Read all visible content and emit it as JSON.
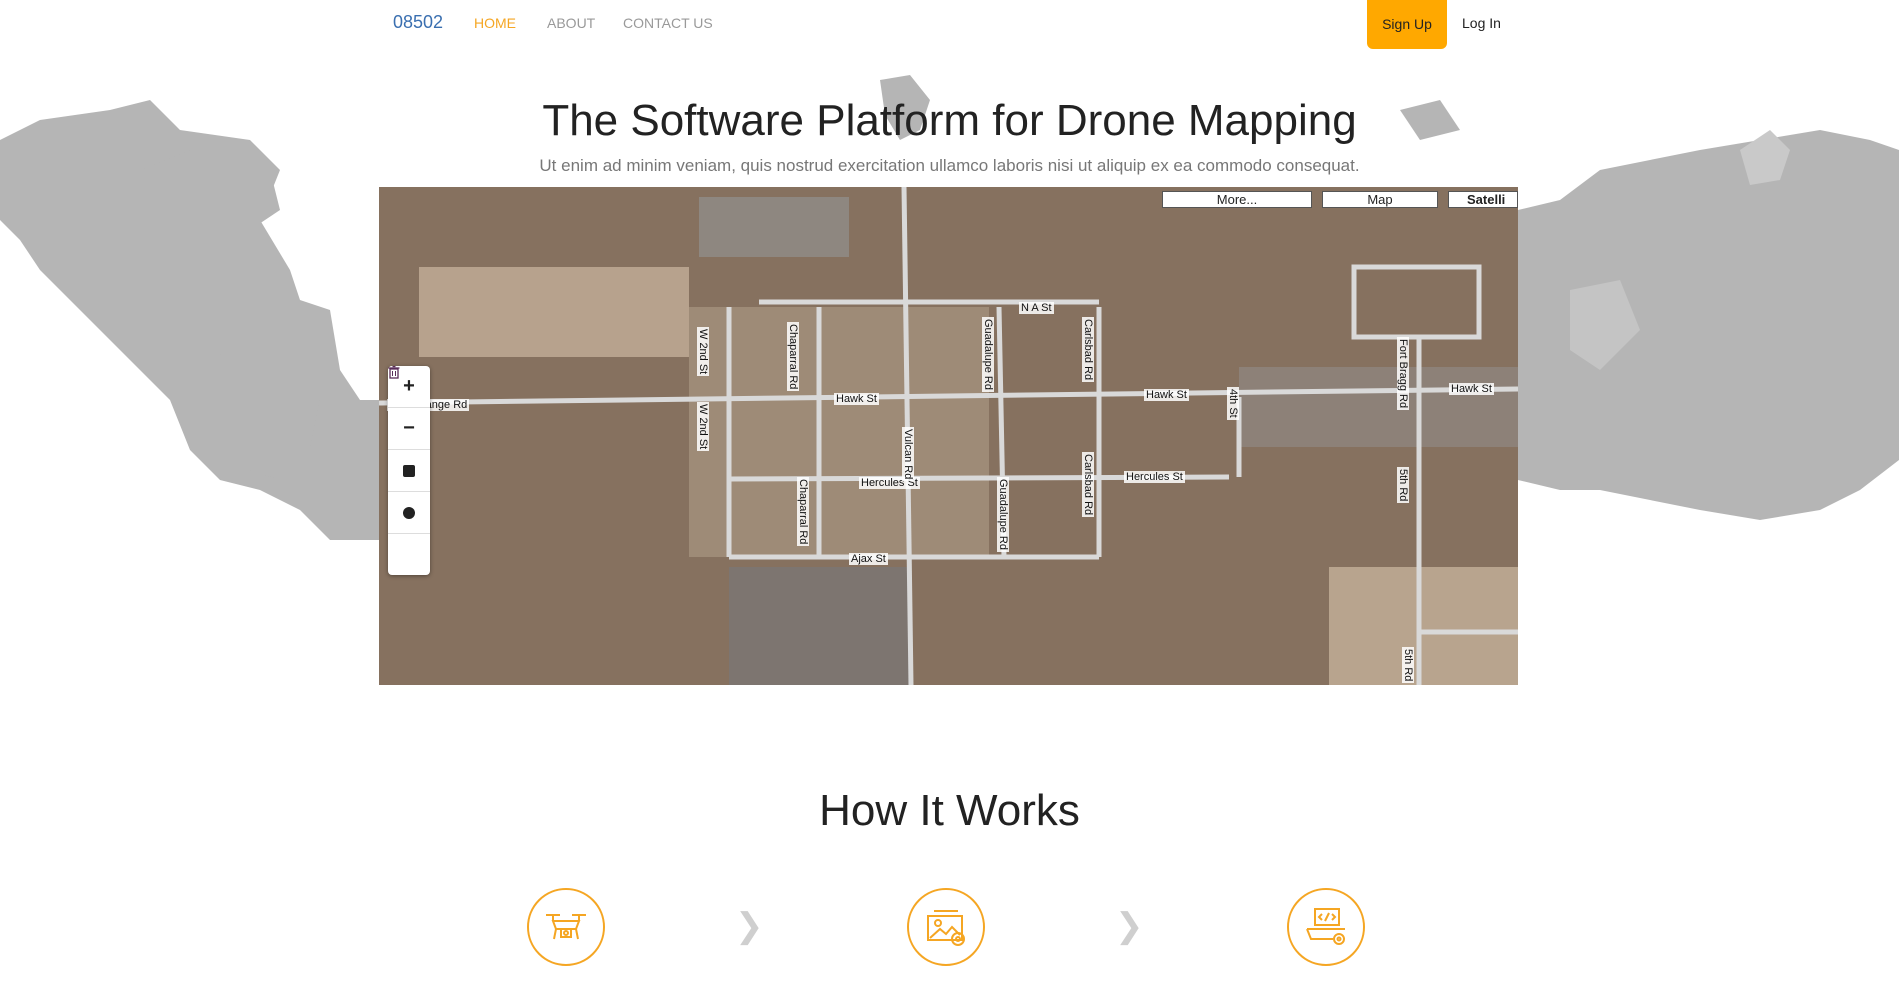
{
  "nav": {
    "brand": "08502",
    "links": [
      "HOME",
      "ABOUT",
      "CONTACT US"
    ],
    "signup": "Sign Up",
    "login": "Log In"
  },
  "hero": {
    "title": "The Software Platform for Drone Mapping",
    "subtitle": "Ut enim ad minim veniam, quis nostrud exercitation ullamco laboris nisi ut aliquip ex ea commodo consequat."
  },
  "map": {
    "types": [
      "More...",
      "Map",
      "Satelli"
    ],
    "controls": [
      "+",
      "−"
    ],
    "roads": [
      "N A St",
      "Hawk St",
      "Hawk St",
      "Hawk St",
      "Hercules St",
      "Hercules St",
      "Ajax St",
      "regor Range Rd",
      "W 2nd St",
      "W 2nd St",
      "Chaparral Rd",
      "Chaparral Rd",
      "Vulcan Rd",
      "Guadalupe Rd",
      "Guadalupe Rd",
      "Carlsbad Rd",
      "Carlsbad Rd",
      "4th St",
      "5th Rd",
      "5th Rd",
      "Fort Bragg Rd"
    ]
  },
  "how": {
    "title": "How It Works"
  },
  "steps": [
    "drone-icon",
    "image-settings-icon",
    "code-screen-icon"
  ],
  "colors": {
    "accent": "#ffa800",
    "brand": "#3a6fb0"
  }
}
